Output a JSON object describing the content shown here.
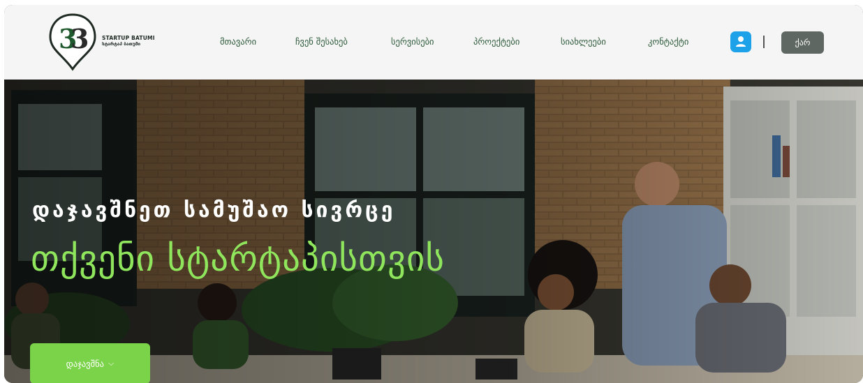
{
  "brand": {
    "line1": "STARTUP BATUMI",
    "line2": "სტარტაპ ბათუმი"
  },
  "nav": {
    "items": [
      {
        "label": "მთავარი"
      },
      {
        "label": "ჩვენ შესახებ"
      },
      {
        "label": "სერვისები"
      },
      {
        "label": "პროექტები"
      },
      {
        "label": "სიახლეები"
      },
      {
        "label": "კონტაქტი"
      }
    ],
    "user_icon": "user-icon",
    "lang_label": "ქარ"
  },
  "hero": {
    "subtitle": "დაჯავშნეთ სამუშაო სივრცე",
    "title": "თქვენი სტარტაპისთვის",
    "cta_label": "დაჯავშნა",
    "cta_icon": "chevron-down-icon"
  },
  "colors": {
    "accent_green": "#7ad349",
    "title_green": "#8fe65c",
    "user_blue": "#1da1e8",
    "lang_gray": "#5e6762"
  }
}
